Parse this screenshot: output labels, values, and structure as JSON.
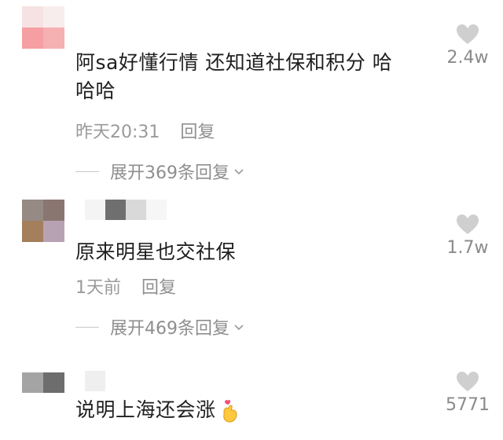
{
  "comments": [
    {
      "text": "阿sa好懂行情 还知道社保和积分 哈哈哈",
      "line1": "阿sa好懂行情 还知道社保和积分 哈",
      "line2": "哈哈",
      "time": "昨天20:31",
      "reply_label": "回复",
      "expand_label": "展开369条回复",
      "likes": "2.4w"
    },
    {
      "text": "原来明星也交社保",
      "time": "1天前",
      "reply_label": "回复",
      "expand_label": "展开469条回复",
      "likes": "1.7w"
    },
    {
      "text": "说明上海还会涨",
      "likes": "5771"
    }
  ],
  "colors": {
    "like_icon": "#cfcfcf",
    "muted_text": "#9a9a9a"
  },
  "icons": {
    "like": "heart-icon",
    "expand": "chevron-down-icon",
    "emoji": "finger-heart-emoji"
  }
}
